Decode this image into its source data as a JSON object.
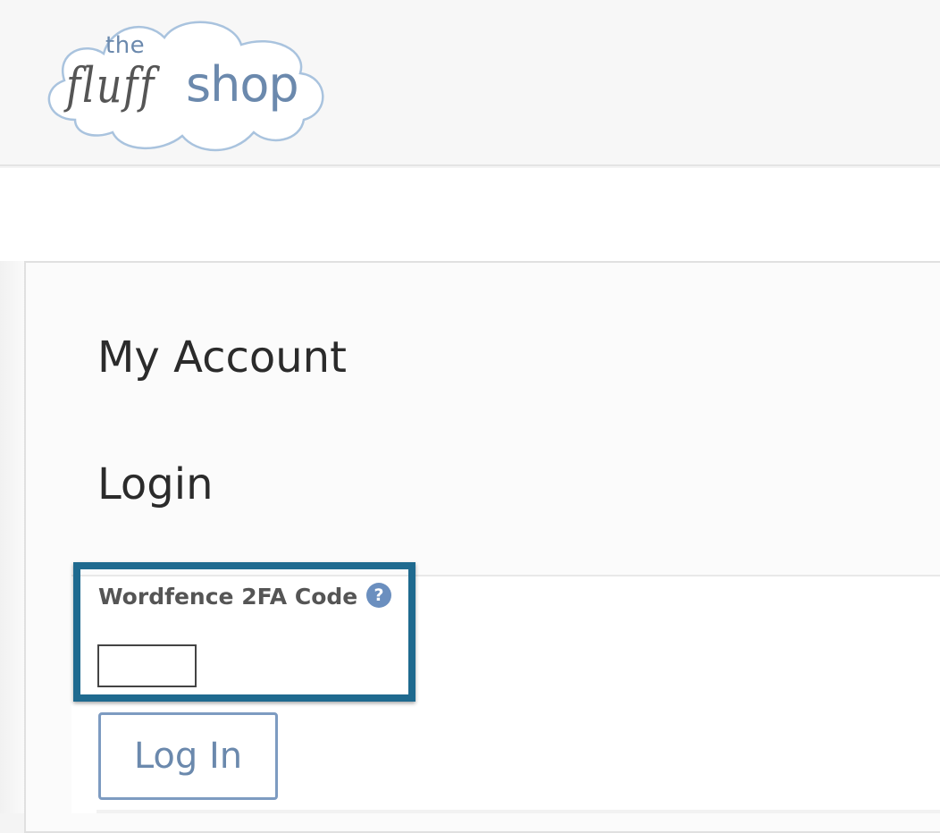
{
  "header": {
    "logo": {
      "the": "the",
      "fluff": "fluff",
      "shop": "shop",
      "cloud_outline_color": "#a9c3de",
      "brand_color": "#6b89ad"
    }
  },
  "main": {
    "page_title": "My Account",
    "section_title": "Login",
    "form": {
      "code_label": "Wordfence 2FA Code",
      "help_icon_glyph": "?",
      "code_value": "",
      "login_button_label": "Log In"
    },
    "highlight_color": "#1f6a8f"
  }
}
